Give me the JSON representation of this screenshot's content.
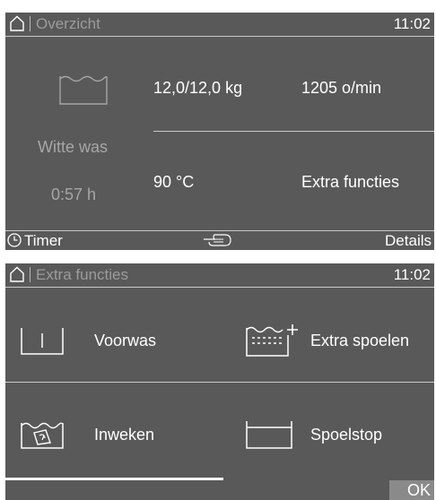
{
  "overview": {
    "header": {
      "title": "Overzicht",
      "time": "11:02"
    },
    "program_icon": "basin-icon",
    "program_name": "Witte was",
    "duration": "0:57 h",
    "load": "12,0/12,0  kg",
    "spin_speed": "1205 o/min",
    "temperature": "90 °C",
    "extra_functions_label": "Extra functies",
    "footer": {
      "timer_label": "Timer",
      "center_icon": "pointing-hand-icon",
      "details_label": "Details"
    }
  },
  "extras": {
    "header": {
      "title": "Extra functies",
      "time": "11:02"
    },
    "options": [
      {
        "label": "Voorwas",
        "icon": "prewash-basin-icon"
      },
      {
        "label": "Extra spoelen",
        "icon": "extra-rinse-icon"
      },
      {
        "label": "Inweken",
        "icon": "soak-icon"
      },
      {
        "label": "Spoelstop",
        "icon": "rinse-hold-icon"
      }
    ],
    "progress": 0.5,
    "ok_label": "OK"
  },
  "colors": {
    "panel_bg": "#595959",
    "text": "#ffffff",
    "dimmed_text": "#a6a6a6",
    "ok_button": "#8a8a8a"
  }
}
